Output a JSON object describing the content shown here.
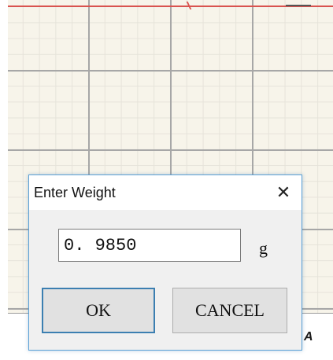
{
  "background": {
    "corner_label": "A"
  },
  "dialog": {
    "title": "Enter Weight",
    "close_glyph": "✕",
    "weight_value": "0. 9850",
    "unit": "g",
    "ok_label": "OK",
    "cancel_label": "CANCEL"
  },
  "colors": {
    "dialog_border": "#5aa0d6",
    "trace": "#d9534f",
    "grid_major": "#a7a7a7",
    "grid_minor": "#e6e3da"
  }
}
